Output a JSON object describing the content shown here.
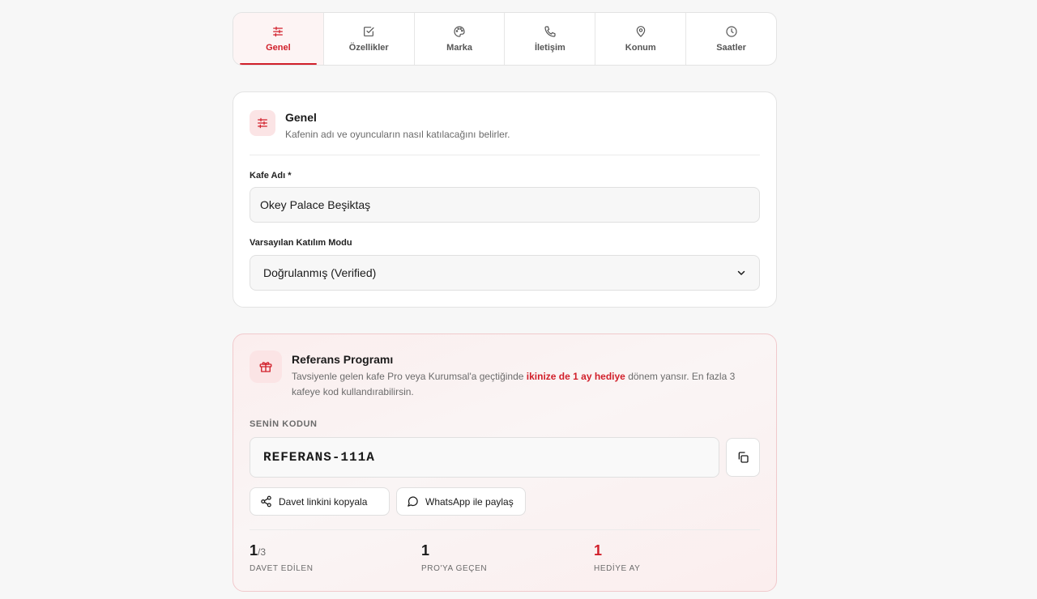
{
  "tabs": [
    {
      "label": "Genel",
      "icon": "sliders-icon",
      "active": true
    },
    {
      "label": "Özellikler",
      "icon": "check-square-icon",
      "active": false
    },
    {
      "label": "Marka",
      "icon": "palette-icon",
      "active": false
    },
    {
      "label": "İletişim",
      "icon": "phone-icon",
      "active": false
    },
    {
      "label": "Konum",
      "icon": "map-pin-icon",
      "active": false
    },
    {
      "label": "Saatler",
      "icon": "clock-icon",
      "active": false
    }
  ],
  "general": {
    "title": "Genel",
    "description": "Kafenin adı ve oyuncuların nasıl katılacağını belirler.",
    "cafe_name_label": "Kafe Adı *",
    "cafe_name_value": "Okey Palace Beşiktaş",
    "join_mode_label": "Varsayılan Katılım Modu",
    "join_mode_value": "Doğrulanmış (Verified)"
  },
  "referral": {
    "title": "Referans Programı",
    "desc_before": "Tavsiyenle gelen kafe Pro veya Kurumsal'a geçtiğinde ",
    "desc_highlight": "ikinize de 1 ay hediye",
    "desc_after": " dönem yansır. En fazla 3 kafeye kod kullandırabilirsin.",
    "code_label": "SENİN KODUN",
    "code": "REFERANS-111A",
    "copy_link_label": "Davet linkini kopyala",
    "whatsapp_label": "WhatsApp ile paylaş",
    "stats": [
      {
        "value": "1",
        "of": "/3",
        "label": "DAVET EDİLEN"
      },
      {
        "value": "1",
        "of": "",
        "label": "PRO'YA GEÇEN"
      },
      {
        "value": "1",
        "of": "",
        "label": "HEDİYE AY"
      }
    ]
  },
  "colors": {
    "accent": "#d11f2a",
    "background": "#f7f7f7"
  }
}
